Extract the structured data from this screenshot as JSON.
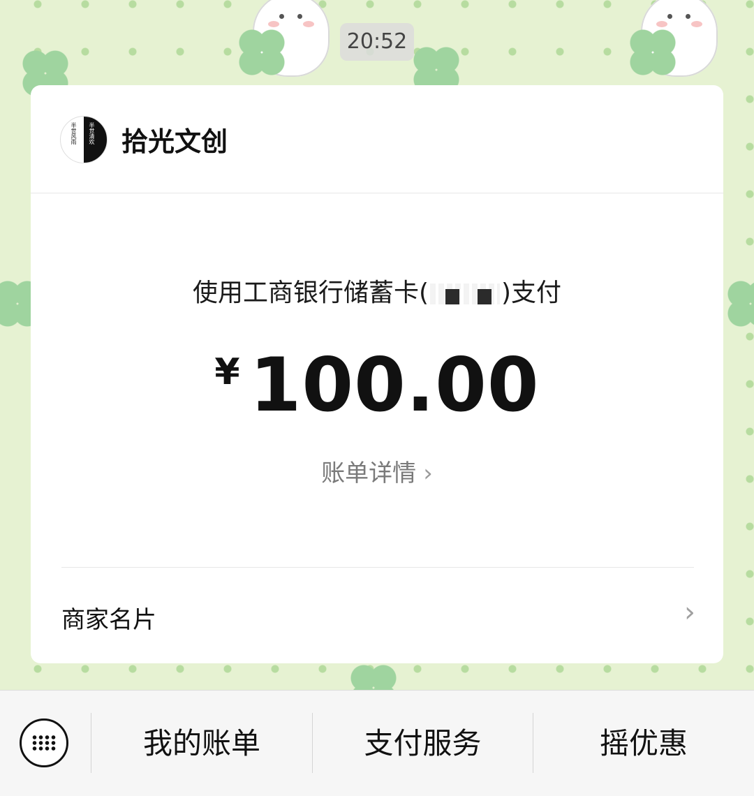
{
  "time_stamp": "20:52",
  "merchant": {
    "name": "拾光文创",
    "logo_text_left": "半世风雨",
    "logo_text_right": "半世清欢"
  },
  "payment": {
    "method_prefix": "使用工商银行储蓄卡(",
    "method_suffix": ")支付",
    "currency_symbol": "¥",
    "amount": "100.00",
    "bill_detail_label": "账单详情",
    "chevron": "›"
  },
  "merchant_card": {
    "label": "商家名片",
    "chevron": "›"
  },
  "menu_bar": {
    "keyboard_icon": "keyboard-icon",
    "items": [
      "我的账单",
      "支付服务",
      "摇优惠"
    ]
  },
  "colors": {
    "wallpaper": "#e6f2d2",
    "card": "#ffffff",
    "text_primary": "#111111",
    "text_secondary": "#7a7a7a"
  }
}
